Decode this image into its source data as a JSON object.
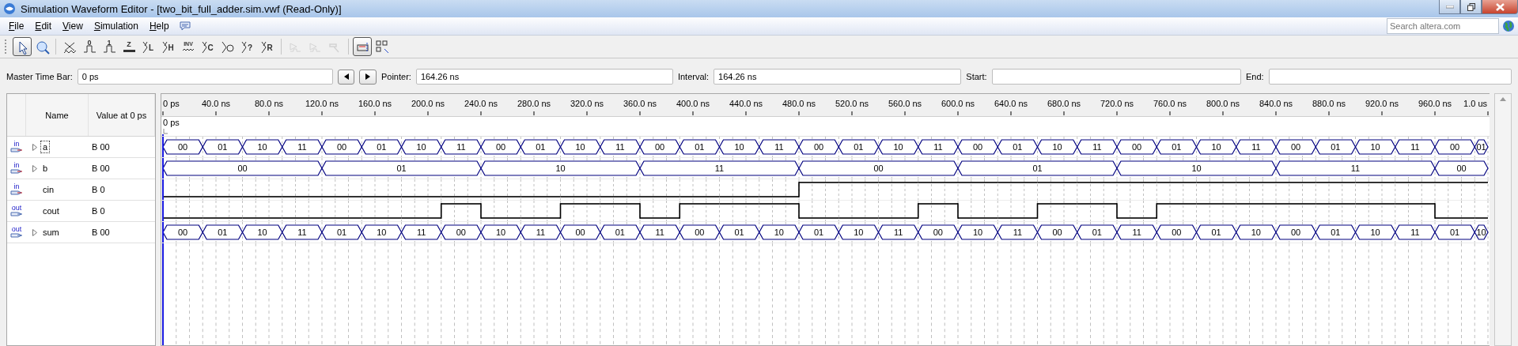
{
  "window": {
    "title": "Simulation Waveform Editor - [two_bit_full_adder.sim.vwf (Read-Only)]"
  },
  "menu": [
    {
      "label": "File"
    },
    {
      "label": "Edit"
    },
    {
      "label": "View"
    },
    {
      "label": "Simulation"
    },
    {
      "label": "Help"
    }
  ],
  "search": {
    "placeholder": "Search altera.com"
  },
  "toolbar": [
    [
      {
        "kind": "pointer",
        "selected": true,
        "disabled": false
      },
      {
        "kind": "zoom",
        "selected": false,
        "disabled": false
      }
    ],
    [
      {
        "kind": "unknown",
        "selected": false,
        "disabled": false
      },
      {
        "kind": "step",
        "label": "0",
        "selected": false,
        "disabled": false
      },
      {
        "kind": "step",
        "label": "1",
        "selected": false,
        "disabled": false
      },
      {
        "kind": "bar",
        "label": "Z",
        "selected": false,
        "disabled": false
      },
      {
        "kind": "cross",
        "label": "L",
        "selected": false,
        "disabled": false
      },
      {
        "kind": "cross",
        "label": "H",
        "selected": false,
        "disabled": false
      },
      {
        "kind": "wave",
        "label": "INV",
        "selected": false,
        "disabled": false
      },
      {
        "kind": "cross",
        "label": "C",
        "selected": false,
        "disabled": false
      },
      {
        "kind": "clock",
        "selected": false,
        "disabled": false
      },
      {
        "kind": "cross",
        "label": "?",
        "selected": false,
        "disabled": false
      },
      {
        "kind": "cross",
        "label": "R",
        "selected": false,
        "disabled": false
      }
    ],
    [
      {
        "kind": "run",
        "selected": false,
        "disabled": true
      },
      {
        "kind": "run",
        "selected": false,
        "disabled": true
      },
      {
        "kind": "hammer",
        "selected": false,
        "disabled": true
      }
    ],
    [
      {
        "kind": "grid",
        "selected": true,
        "disabled": false
      },
      {
        "kind": "snap",
        "selected": false,
        "disabled": false
      }
    ]
  ],
  "time_bar": {
    "master_label": "Master Time Bar:",
    "master_value": "0 ps",
    "pointer_label": "Pointer:",
    "pointer_value": "164.26 ns",
    "interval_label": "Interval:",
    "interval_value": "164.26 ns",
    "start_label": "Start:",
    "end_label": "End:"
  },
  "table": {
    "columns": [
      "Name",
      "Value at 0 ps"
    ]
  },
  "ruler": {
    "ticks": [
      "0 ps",
      "40.0 ns",
      "80.0 ns",
      "120.0 ns",
      "160.0 ns",
      "200.0 ns",
      "240.0 ns",
      "280.0 ns",
      "320.0 ns",
      "360.0 ns",
      "400.0 ns",
      "440.0 ns",
      "480.0 ns",
      "520.0 ns",
      "560.0 ns",
      "600.0 ns",
      "640.0 ns",
      "680.0 ns",
      "720.0 ns",
      "760.0 ns",
      "800.0 ns",
      "840.0 ns",
      "880.0 ns",
      "920.0 ns",
      "960.0 ns",
      "1.0 us"
    ],
    "marker": "0 ps"
  },
  "signals": [
    {
      "direction": "in",
      "name": "a",
      "value": "B 00",
      "expandable": true,
      "focused": true,
      "kind": "bus",
      "segments": [
        "00",
        "01",
        "10",
        "11",
        "00",
        "01",
        "10",
        "11",
        "00",
        "01",
        "10",
        "11",
        "00",
        "01",
        "10",
        "11",
        "00",
        "01",
        "10",
        "11",
        "00",
        "01",
        "10",
        "11",
        "00",
        "01",
        "10",
        "11",
        "00",
        "01",
        "10",
        "11",
        "00",
        "01"
      ]
    },
    {
      "direction": "in",
      "name": "b",
      "value": "B 00",
      "expandable": true,
      "focused": false,
      "kind": "bus",
      "segments": [
        "00",
        "01",
        "10",
        "11",
        "00",
        "01",
        "10",
        "11",
        "00"
      ]
    },
    {
      "direction": "in",
      "name": "cin",
      "value": "B 0",
      "expandable": false,
      "focused": false,
      "kind": "bit",
      "high": [
        false,
        false,
        false,
        false,
        false,
        false,
        false,
        false,
        false,
        false,
        false,
        false,
        false,
        false,
        false,
        false,
        true,
        true,
        true,
        true,
        true,
        true,
        true,
        true,
        true,
        true,
        true,
        true,
        true,
        true,
        true,
        true,
        true,
        true
      ]
    },
    {
      "direction": "out",
      "name": "cout",
      "value": "B 0",
      "expandable": false,
      "focused": false,
      "kind": "bit",
      "high": [
        false,
        false,
        false,
        false,
        false,
        false,
        false,
        true,
        false,
        false,
        true,
        true,
        false,
        true,
        true,
        true,
        false,
        false,
        false,
        true,
        false,
        false,
        true,
        true,
        false,
        true,
        true,
        true,
        true,
        true,
        true,
        true,
        false,
        false
      ]
    },
    {
      "direction": "out",
      "name": "sum",
      "value": "B 00",
      "expandable": true,
      "focused": false,
      "kind": "bus",
      "segments": [
        "00",
        "01",
        "10",
        "11",
        "01",
        "10",
        "11",
        "00",
        "10",
        "11",
        "00",
        "01",
        "11",
        "00",
        "01",
        "10",
        "01",
        "10",
        "11",
        "00",
        "10",
        "11",
        "00",
        "01",
        "11",
        "00",
        "01",
        "10",
        "00",
        "01",
        "10",
        "11",
        "01",
        "10"
      ]
    }
  ]
}
